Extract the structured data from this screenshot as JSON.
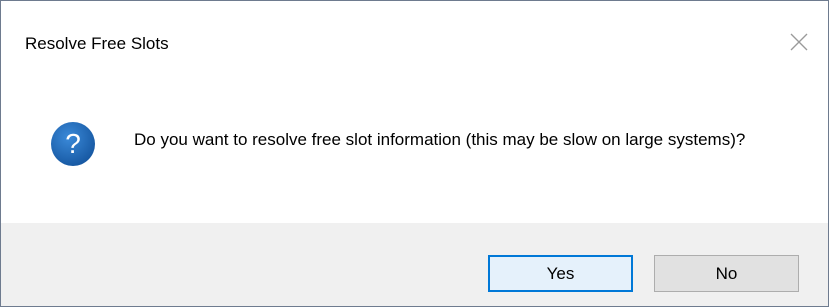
{
  "dialog": {
    "title": "Resolve Free Slots",
    "icon": "question-icon",
    "message": "Do you want to resolve free slot information (this may be slow on large systems)?",
    "buttons": {
      "yes_label": "Yes",
      "no_label": "No"
    },
    "colors": {
      "icon_blue": "#1e68b3",
      "default_button_border": "#0078d7",
      "footer_background": "#f0f0f0"
    }
  }
}
